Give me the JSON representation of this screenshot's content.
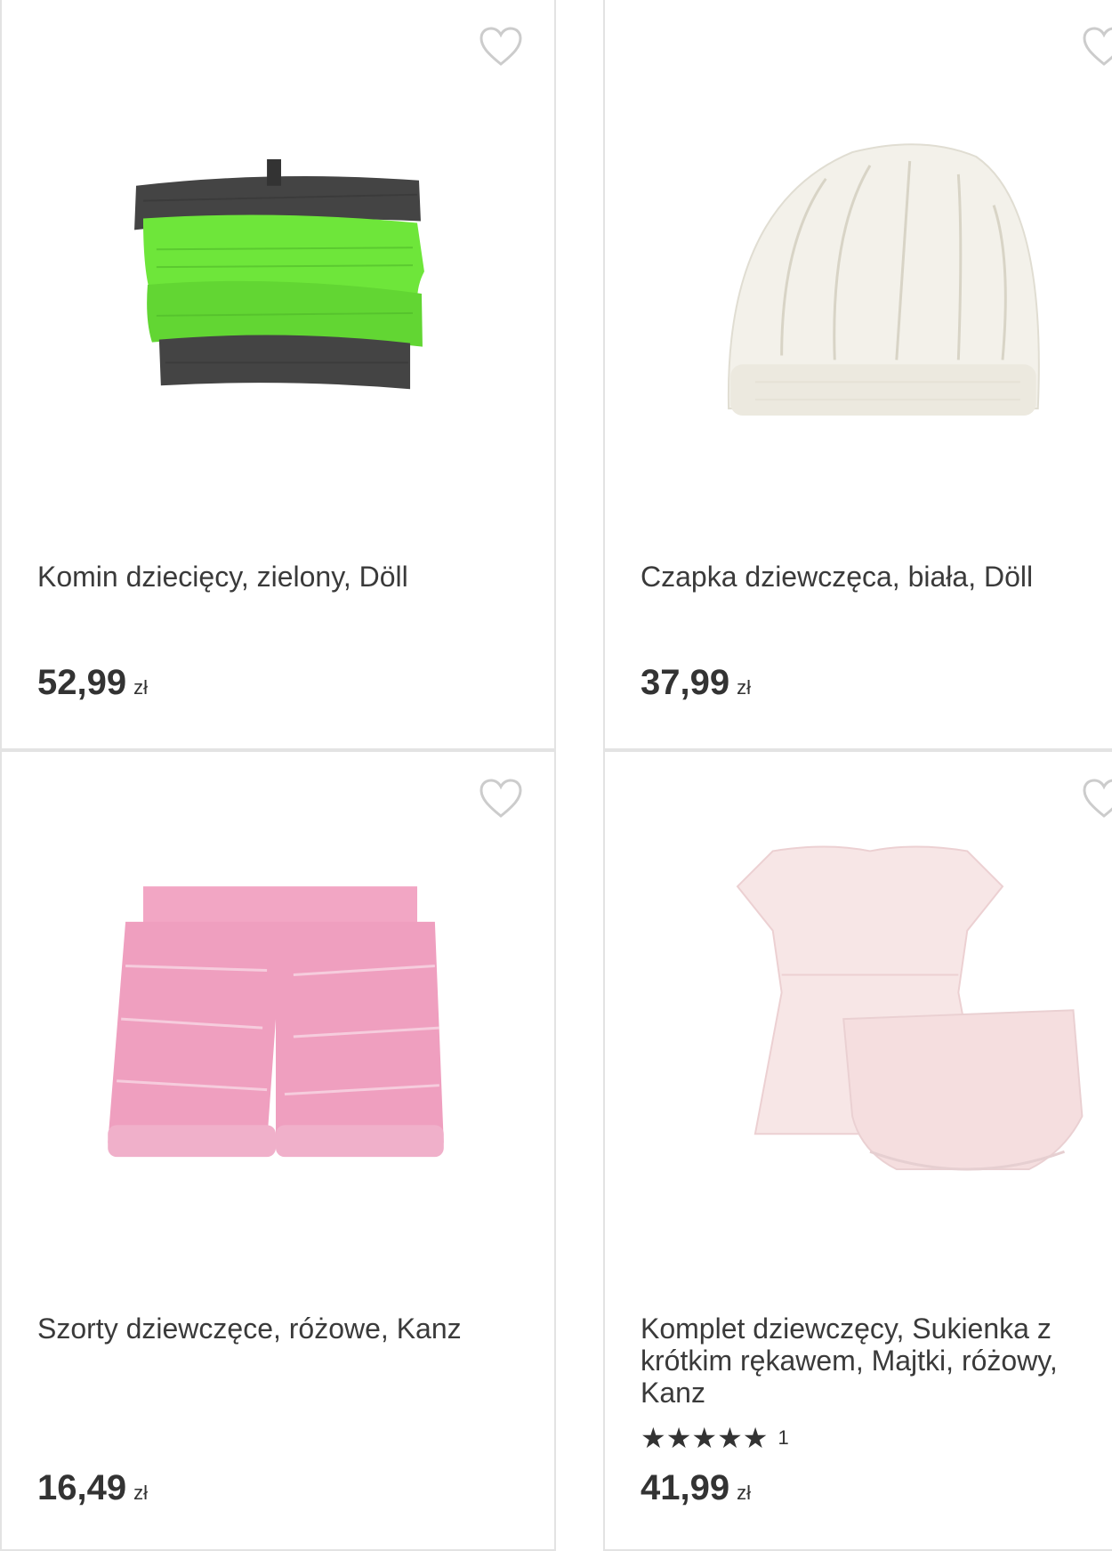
{
  "products": [
    {
      "title": "Komin dziecięcy, zielony, Döll",
      "price": "52,99",
      "currency": "zł",
      "image_icon": "green-snood-image"
    },
    {
      "title": "Czapka dziewczęca, biała, Döll",
      "price": "37,99",
      "currency": "zł",
      "image_icon": "white-knit-hat-image"
    },
    {
      "title": "Szorty dziewczęce, różowe, Kanz",
      "price": "16,49",
      "currency": "zł",
      "image_icon": "pink-shorts-image"
    },
    {
      "title": "Komplet dziewczęcy, Sukienka z krótkim rękawem, Majtki, różowy, Kanz",
      "price": "41,99",
      "currency": "zł",
      "rating_stars": "★★★★★",
      "rating_count": "1",
      "image_icon": "pink-dress-set-image"
    }
  ],
  "colors": {
    "border": "#e3e3e3",
    "text": "#333333",
    "heart": "#cccccc"
  }
}
